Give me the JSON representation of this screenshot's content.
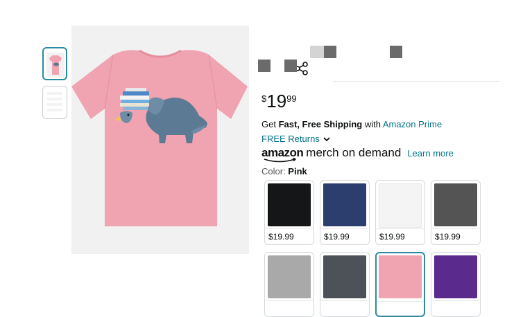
{
  "thumbnails": [
    {
      "name": "pink-shirt-thumbnail",
      "selected": true
    },
    {
      "name": "size-chart-thumbnail",
      "selected": false
    }
  ],
  "product_image": {
    "icon": "share-icon"
  },
  "price": {
    "currency": "$",
    "whole": "19",
    "fraction": "99"
  },
  "shipping": {
    "prefix": "Get ",
    "bold": "Fast, Free Shipping",
    "middle": " with ",
    "link": "Amazon Prime"
  },
  "returns": {
    "label": "FREE Returns",
    "icon": "chevron-down-icon"
  },
  "merch": {
    "brand": "amazon",
    "rest": "merch on demand",
    "learn_more": "Learn more"
  },
  "color": {
    "label": "Color: ",
    "value": "Pink"
  },
  "swatches": [
    {
      "color": "#141618",
      "price": "$19.99"
    },
    {
      "color": "#2c3e6e",
      "price": "$19.99"
    },
    {
      "color": "#f4f4f4",
      "price": "$19.99"
    },
    {
      "color": "#545454",
      "price": "$19.99"
    },
    {
      "color": "#a9a9a9",
      "price": ""
    },
    {
      "color": "#4d5258",
      "price": ""
    },
    {
      "color": "#f0a3b1",
      "price": "",
      "selected": true
    },
    {
      "color": "#5a2a8c",
      "price": ""
    }
  ],
  "colors": {
    "link": "#007185",
    "selected_border": "#2a8aa0",
    "shirt": "#f0a3b1"
  }
}
